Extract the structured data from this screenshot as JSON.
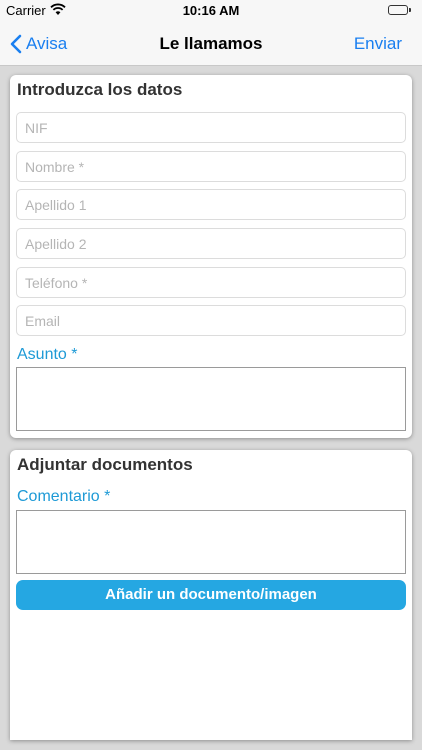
{
  "status_bar": {
    "carrier": "Carrier",
    "time": "10:16 AM",
    "battery_color": "#4cd964"
  },
  "nav": {
    "back_label": "Avisa",
    "title": "Le llamamos",
    "action_label": "Enviar",
    "accent_color": "#1a7ff0"
  },
  "form": {
    "title": "Introduzca los datos",
    "fields": [
      {
        "name": "nif",
        "placeholder": "NIF",
        "value": ""
      },
      {
        "name": "nombre",
        "placeholder": "Nombre *",
        "value": ""
      },
      {
        "name": "apellido1",
        "placeholder": "Apellido 1",
        "value": ""
      },
      {
        "name": "apellido2",
        "placeholder": "Apellido 2",
        "value": ""
      },
      {
        "name": "telefono",
        "placeholder": "Teléfono *",
        "value": ""
      },
      {
        "name": "email",
        "placeholder": "Email",
        "value": ""
      }
    ],
    "subject_label": "Asunto *",
    "subject_value": ""
  },
  "attachments": {
    "title": "Adjuntar documentos",
    "comment_label": "Comentario *",
    "comment_value": "",
    "add_button_label": "Añadir un documento/imagen",
    "button_color": "#25a7e2"
  }
}
